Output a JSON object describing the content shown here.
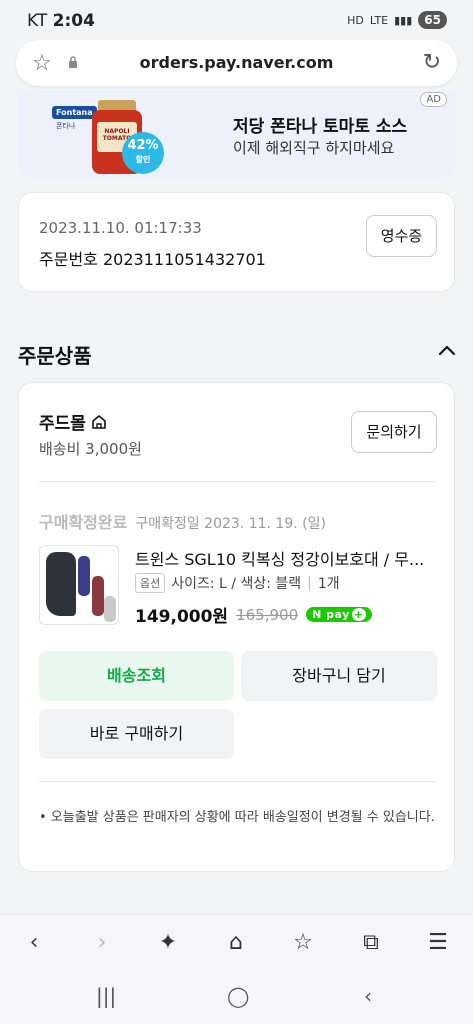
{
  "status_bar": {
    "carrier": "KT",
    "time": "2:04",
    "network": "LTE",
    "battery": "65"
  },
  "browser": {
    "url": "orders.pay.naver.com"
  },
  "ad": {
    "brand": "Fontana",
    "brand_sub": "폰타나",
    "product_label": "NAPOLI TOMATO",
    "discount": "42%",
    "discount_label": "할인",
    "title": "저당 폰타나 토마토 소스",
    "subtitle": "이제 해외직구 하지마세요",
    "badge": "AD"
  },
  "order": {
    "datetime": "2023.11.10. 01:17:33",
    "number_label": "주문번호",
    "number": "2023111051432701",
    "receipt_button": "영수증"
  },
  "section": {
    "title": "주문상품"
  },
  "shop": {
    "name": "주드몰",
    "shipping_fee": "배송비 3,000원",
    "inquiry_button": "문의하기"
  },
  "item": {
    "status": "구매확정완료",
    "status_date": "구매확정일 2023. 11. 19. (일)",
    "name": "트윈스 SGL10 킥복싱 정강이보호대 / 무...",
    "option_tag": "옵션",
    "option_text": "사이즈: L / 색상: 블랙",
    "quantity": "1개",
    "price": "149,000원",
    "original_price": "165,900",
    "npay": "N pay",
    "npay_plus": "+"
  },
  "actions": {
    "track": "배송조회",
    "cart": "장바구니 담기",
    "buy_now": "바로 구매하기"
  },
  "notice": "• 오늘출발 상품은 판매자의 상황에 따라 배송일정이 변경될 수 있습니다.",
  "colors": {
    "accent_green": "#15a84a",
    "npay_green": "#1ec800",
    "discount_blue": "#2eb8e6"
  }
}
